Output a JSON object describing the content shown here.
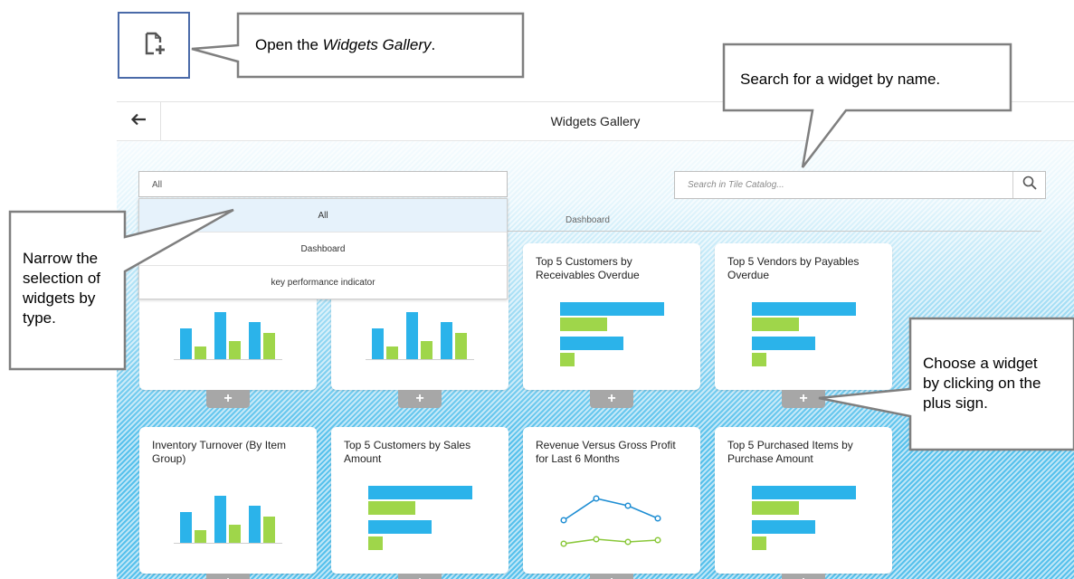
{
  "callouts": {
    "open_gallery_pre": "Open the ",
    "open_gallery_em": "Widgets Gallery",
    "open_gallery_post": ".",
    "search": "Search for a widget by name.",
    "narrow_lines": [
      "Narrow the",
      "selection of",
      "widgets by",
      "type."
    ],
    "choose_lines": [
      "Choose a widget",
      "by clicking on the",
      "plus sign."
    ]
  },
  "app": {
    "title": "Widgets Gallery",
    "filter": {
      "selected": "All",
      "options": [
        "All",
        "Dashboard",
        "key performance indicator"
      ]
    },
    "search": {
      "placeholder": "Search in Tile Catalog..."
    },
    "group_label": "Dashboard",
    "plus_symbol": "+",
    "tiles": [
      {
        "title": "",
        "chart": "column"
      },
      {
        "title": "",
        "chart": "column"
      },
      {
        "title": "Top 5 Customers by Receivables Overdue",
        "chart": "hbar"
      },
      {
        "title": "Top 5 Vendors by Payables Overdue",
        "chart": "hbar"
      },
      {
        "title": "Inventory Turnover (By Item Group)",
        "chart": "column"
      },
      {
        "title": "Top 5 Customers by Sales Amount",
        "chart": "hbar"
      },
      {
        "title": "Revenue Versus Gross Profit for Last 6 Months",
        "chart": "line"
      },
      {
        "title": "Top 5 Purchased Items by Purchase Amount",
        "chart": "hbar"
      }
    ]
  },
  "icons": {
    "gallery": "add-document-icon",
    "back": "arrow-left-icon",
    "search": "magnifier-icon"
  },
  "colors": {
    "blue": "#2bb3ea",
    "green": "#9fd64a",
    "line_blue": "#1f8ed3",
    "line_green": "#8ac83a",
    "callout_border": "#7f7f7f",
    "icon_box_border": "#4a6aa8",
    "plus_button": "#a7a7a7"
  }
}
